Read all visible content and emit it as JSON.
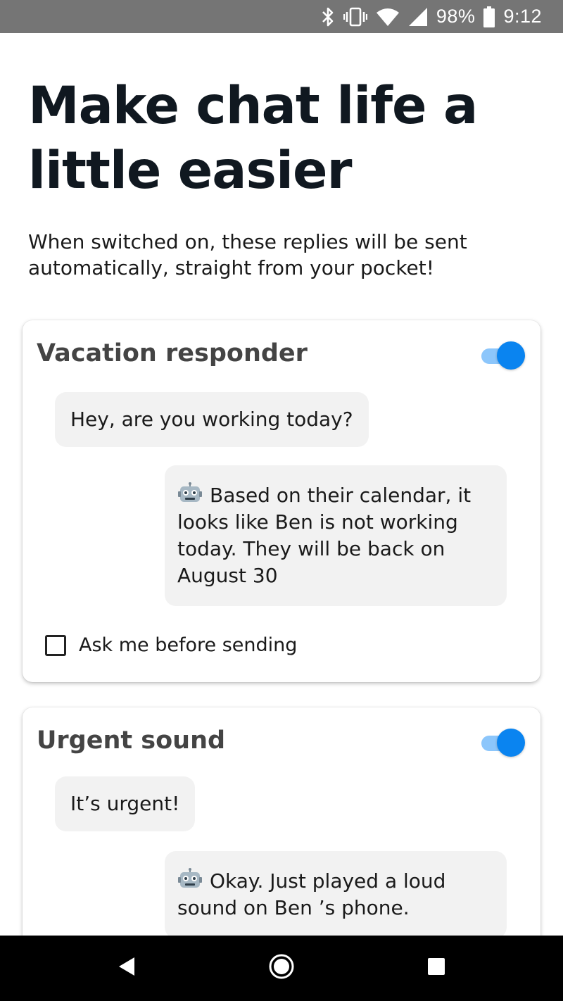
{
  "status_bar": {
    "battery_percent": "98%",
    "time": "9:12",
    "icons": [
      "bluetooth-icon",
      "vibrate-icon",
      "wifi-icon",
      "signal-icon",
      "battery-icon"
    ]
  },
  "page": {
    "title": "Make chat life a little easier",
    "subtitle": "When switched on, these replies will be sent automatically, straight from your pocket!"
  },
  "cards": [
    {
      "title": "Vacation responder",
      "enabled": true,
      "incoming_message": "Hey, are you working today?",
      "reply_message": "Based on their calendar, it looks like Ben is not working today. They will be back on August 30",
      "ask_label": "Ask me before sending",
      "ask_checked": false
    },
    {
      "title": "Urgent sound",
      "enabled": true,
      "incoming_message": "It’s urgent!",
      "reply_message": "Okay. Just played a loud sound on Ben ’s phone."
    }
  ],
  "colors": {
    "accent": "#0a84f0",
    "accent_track": "#8cc6fb",
    "bubble_bg": "#f2f2f2",
    "status_bar_bg": "#757575",
    "nav_bar_bg": "#000000"
  },
  "nav_bar": {
    "icons": [
      "back-icon",
      "home-icon",
      "recent-apps-icon"
    ]
  }
}
